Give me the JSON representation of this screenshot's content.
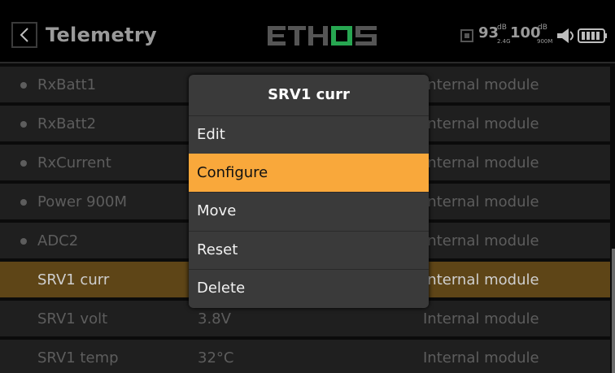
{
  "header": {
    "title": "Telemetry",
    "logo_text": "ETHOS",
    "rssi_24": {
      "value": "93",
      "unit": "dB",
      "band": "2.4G"
    },
    "rssi_900": {
      "value": "100",
      "unit": "dB",
      "band": "900M"
    }
  },
  "rows": [
    {
      "name": "RxBatt1",
      "value": "",
      "module": "Internal module",
      "dot": true,
      "selected": false
    },
    {
      "name": "RxBatt2",
      "value": "",
      "module": "Internal module",
      "dot": true,
      "selected": false
    },
    {
      "name": "RxCurrent",
      "value": "",
      "module": "Internal module",
      "dot": true,
      "selected": false
    },
    {
      "name": "Power 900M",
      "value": "",
      "module": "Internal module",
      "dot": true,
      "selected": false
    },
    {
      "name": "ADC2",
      "value": "",
      "module": "Internal module",
      "dot": true,
      "selected": false
    },
    {
      "name": "SRV1 curr",
      "value": "",
      "module": "Internal module",
      "dot": false,
      "selected": true
    },
    {
      "name": "SRV1 volt",
      "value": "3.8V",
      "module": "Internal module",
      "dot": false,
      "selected": false
    },
    {
      "name": "SRV1 temp",
      "value": "32°C",
      "module": "Internal module",
      "dot": false,
      "selected": false
    }
  ],
  "popup": {
    "title": "SRV1 curr",
    "items": [
      {
        "label": "Edit",
        "active": false
      },
      {
        "label": "Configure",
        "active": true
      },
      {
        "label": "Move",
        "active": false
      },
      {
        "label": "Reset",
        "active": false
      },
      {
        "label": "Delete",
        "active": false
      }
    ]
  },
  "colors": {
    "accent": "#f9a83b",
    "selected_row": "#5e4517",
    "logo_accent": "#2ecc71"
  }
}
